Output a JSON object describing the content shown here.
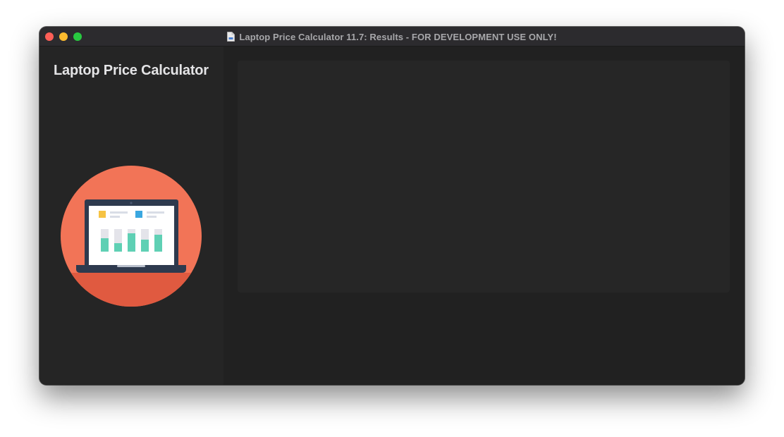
{
  "window": {
    "title": "Laptop Price Calculator 11.7: Results - FOR DEVELOPMENT USE ONLY!",
    "controls": [
      "close-icon",
      "minimize-icon",
      "maximize-icon"
    ]
  },
  "sidebar": {
    "title": "Laptop Price Calculator",
    "logo_icon": "laptop-chart-icon"
  },
  "main": {
    "results_panel": ""
  },
  "colors": {
    "logo_circle": "#f26d50",
    "laptop_body": "#2e3a4e",
    "bar_green": "#5fd0b4",
    "legend_yellow": "#f6c343",
    "legend_blue": "#3aa7e0"
  }
}
